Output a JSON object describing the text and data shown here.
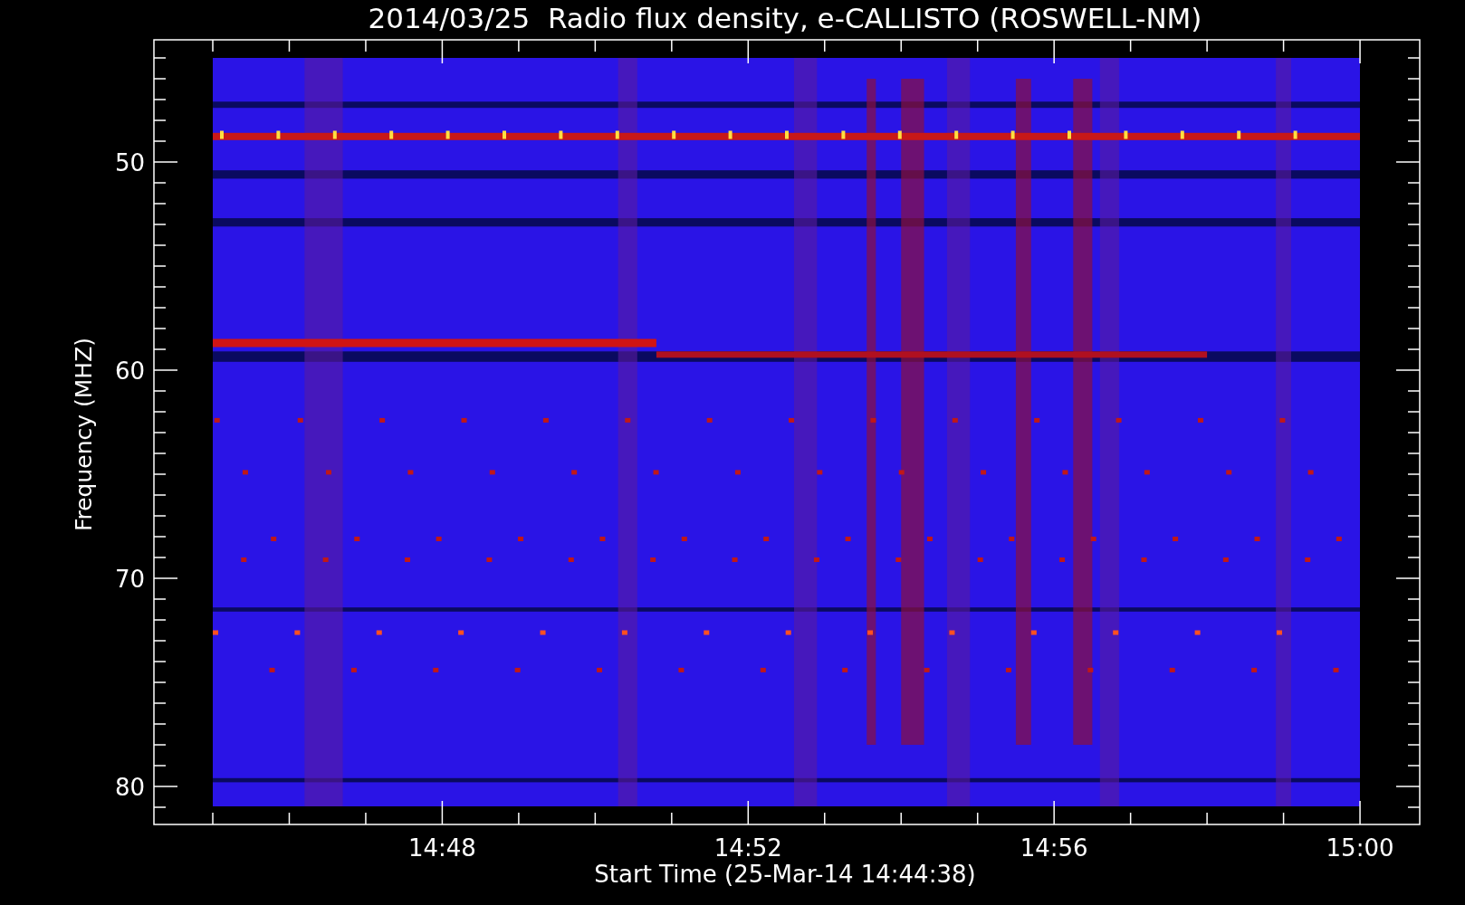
{
  "plot": {
    "title": "2014/03/25  Radio flux density, e-CALLISTO (ROSWELL-NM)",
    "xlabel": "Start Time (25-Mar-14 14:44:38)",
    "ylabel": "Frequency (MHZ)",
    "xtick_labels": [
      "14:48",
      "14:52",
      "14:56",
      "15:00"
    ],
    "ytick_labels": [
      "50",
      "60",
      "70",
      "80"
    ]
  }
}
